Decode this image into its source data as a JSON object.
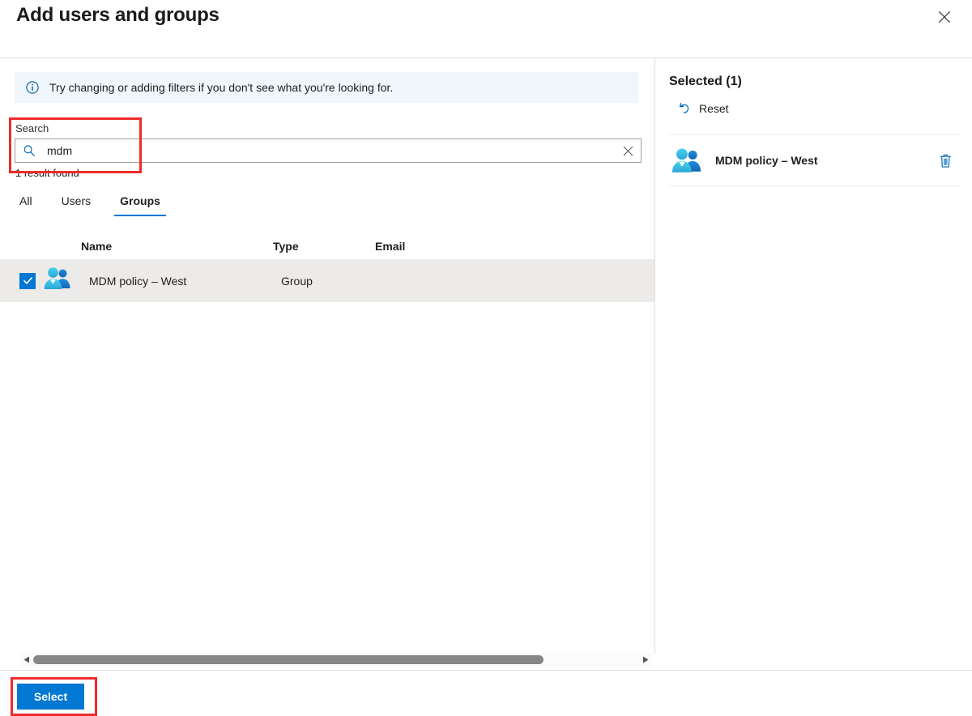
{
  "header": {
    "title": "Add users and groups",
    "close_icon": "close-icon"
  },
  "infobar": {
    "icon": "info-circle-icon",
    "message": "Try changing or adding filters if you don't see what you're looking for."
  },
  "search": {
    "label": "Search",
    "value": "mdm",
    "placeholder": "Search",
    "search_icon": "search-icon",
    "clear_icon": "clear-icon",
    "result_text": "1 result found"
  },
  "tabs": [
    {
      "label": "All",
      "active": false
    },
    {
      "label": "Users",
      "active": false
    },
    {
      "label": "Groups",
      "active": true
    }
  ],
  "table": {
    "columns": [
      "Name",
      "Type",
      "Email"
    ],
    "rows": [
      {
        "checked": true,
        "icon": "group-people-icon",
        "name": "MDM policy – West",
        "type": "Group",
        "email": ""
      }
    ]
  },
  "scrollbar": {
    "left_arrow_icon": "chevron-left-icon",
    "right_arrow_icon": "chevron-right-icon"
  },
  "selected_panel": {
    "title": "Selected (1)",
    "reset": {
      "label": "Reset",
      "icon": "undo-arrow-icon"
    },
    "items": [
      {
        "icon": "group-people-icon",
        "name": "MDM policy – West",
        "delete_icon": "trash-icon"
      }
    ]
  },
  "footer": {
    "select_label": "Select"
  },
  "colors": {
    "accent": "#0078d4",
    "info_background": "#eff6fc",
    "row_selected_background": "#edebe9",
    "annotation": "#ef2b2b",
    "divider": "#e1dfdd"
  }
}
